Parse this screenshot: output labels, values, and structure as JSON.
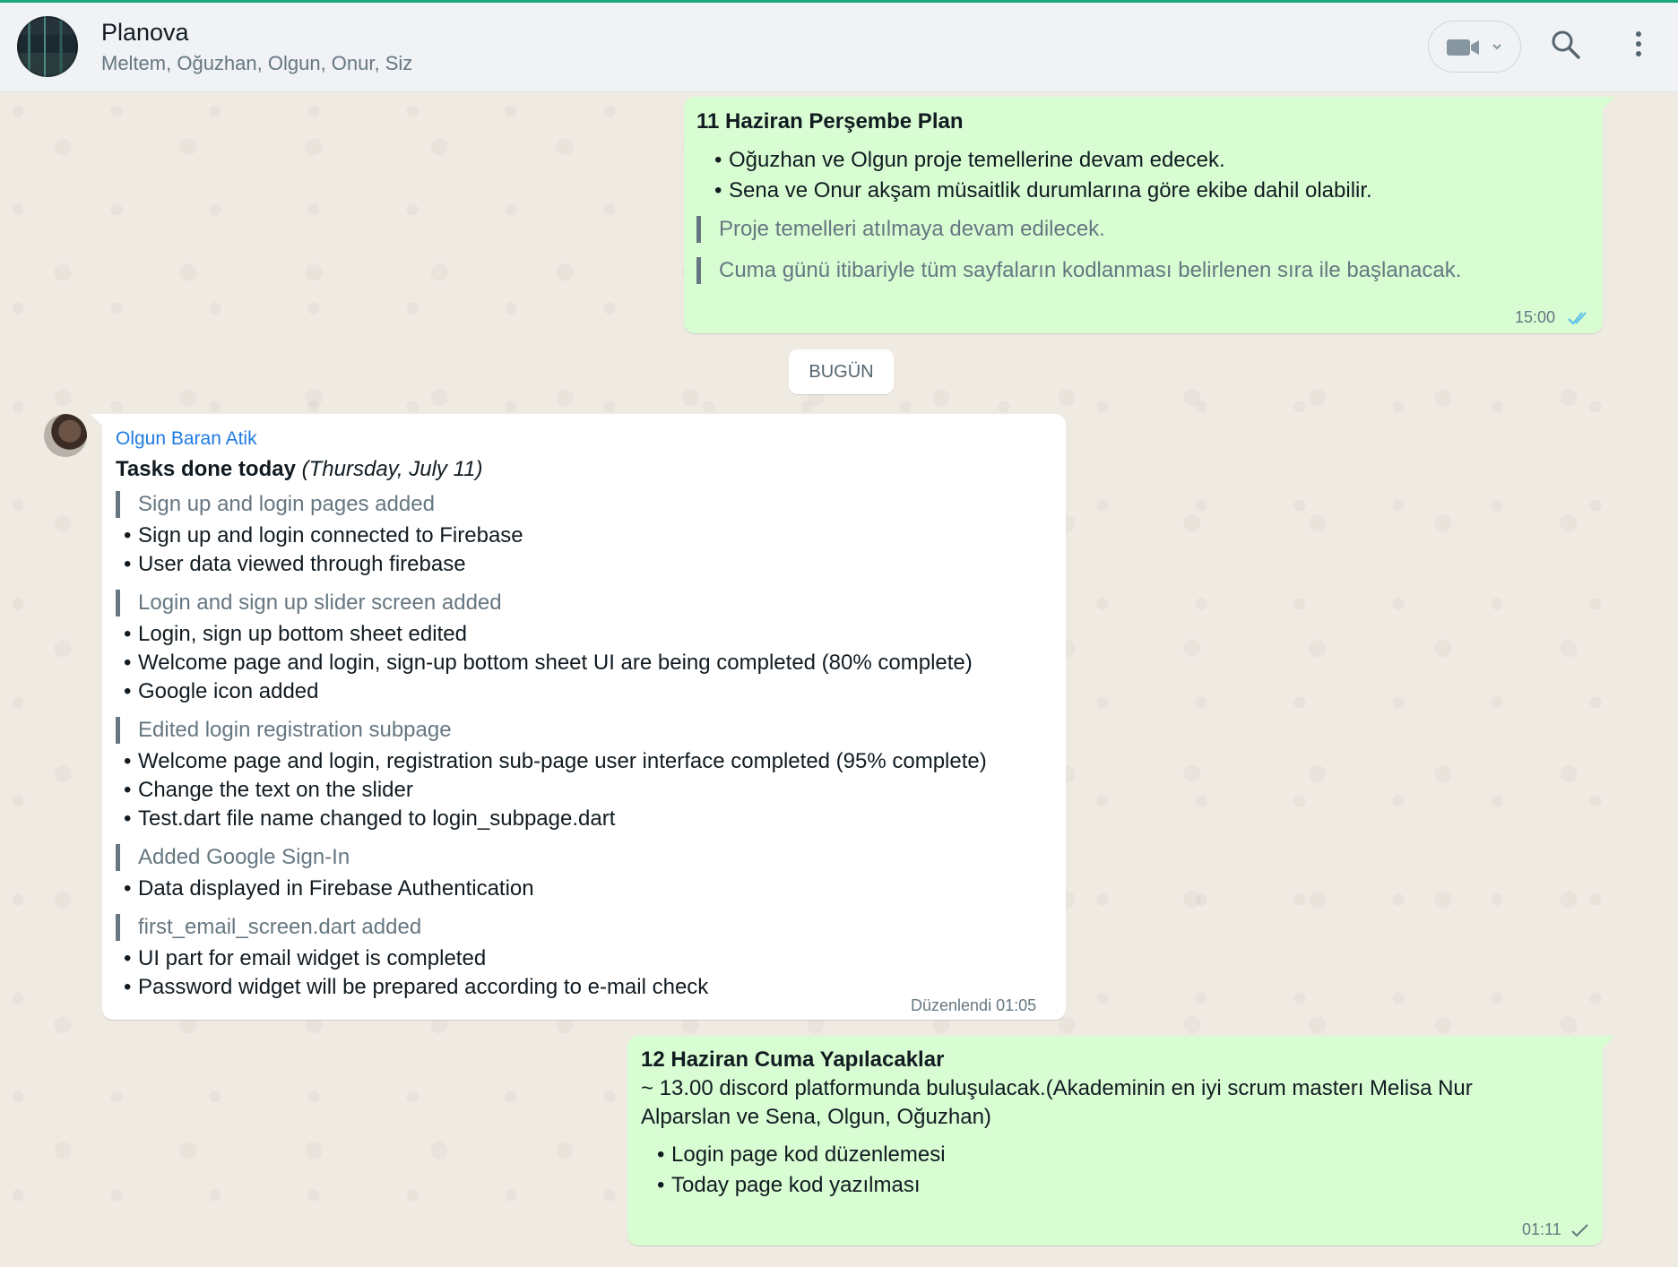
{
  "header": {
    "group_name": "Planova",
    "members": "Meltem, Oğuzhan, Olgun, Onur, Siz",
    "icons": [
      "group-avatar",
      "video-call-icon",
      "chevron-down-icon",
      "search-icon",
      "more-vertical-icon"
    ]
  },
  "messages": [
    {
      "title": "11 Haziran Perşembe Plan",
      "bullets": [
        "Oğuzhan ve Olgun proje temellerine devam edecek.",
        "Sena ve Onur akşam müsaitlik durumlarına göre ekibe dahil olabilir."
      ],
      "quotes": [
        "Proje temelleri atılmaya devam edilecek.",
        "Cuma günü itibariyle tüm sayfaların kodlanması belirlenen sıra ile başlanacak."
      ],
      "time": "15:00"
    },
    {
      "sender": "Olgun Baran Atik",
      "title_bold": "Tasks done today",
      "title_italic": "(Thursday, July 11)",
      "items": [
        {
          "type": "quote",
          "text": "Sign up and login pages added"
        },
        {
          "type": "bullet",
          "text": "Sign up and login connected to Firebase"
        },
        {
          "type": "bullet",
          "text": "User data viewed through firebase"
        },
        {
          "type": "quote",
          "text": "Login and sign up slider screen added"
        },
        {
          "type": "bullet",
          "text": "Login, sign up bottom sheet edited"
        },
        {
          "type": "bullet",
          "text": "Welcome page and login, sign-up bottom sheet UI are being completed (80% complete)"
        },
        {
          "type": "bullet",
          "text": "Google icon added"
        },
        {
          "type": "quote",
          "text": "Edited login registration subpage"
        },
        {
          "type": "bullet",
          "text": "Welcome page and login, registration sub-page user interface completed (95% complete)"
        },
        {
          "type": "bullet",
          "text": "Change the text on the slider"
        },
        {
          "type": "bullet",
          "text": "Test.dart file name changed to login_subpage.dart"
        },
        {
          "type": "quote",
          "text": "Added Google Sign-In"
        },
        {
          "type": "bullet",
          "text": "Data displayed in Firebase Authentication"
        },
        {
          "type": "quote",
          "text": "first_email_screen.dart added"
        },
        {
          "type": "bullet",
          "text": "UI part for email widget is completed"
        },
        {
          "type": "bullet",
          "text": "Password widget will be prepared according to e-mail check"
        }
      ],
      "time": "Düzenlendi 01:05"
    },
    {
      "title": "12 Haziran Cuma Yapılacaklar",
      "body_line1": "~ 13.00 discord platformunda buluşulacak.(Akademinin en iyi scrum masterı Melisa Nur",
      "body_line2": "Alparslan ve Sena, Olgun, Oğuzhan)",
      "bullets": [
        "Login page kod düzenlemesi",
        "Today page kod yazılması"
      ],
      "time": "01:11"
    }
  ],
  "date_chip": "BUGÜN",
  "bullet_char": "•",
  "colors": {
    "outgoing_bubble": "#d9fdd3",
    "incoming_bubble": "#ffffff",
    "sender_name": "#1f7ae0",
    "read_ticks": "#53bdeb",
    "sent_tick": "#667781"
  }
}
